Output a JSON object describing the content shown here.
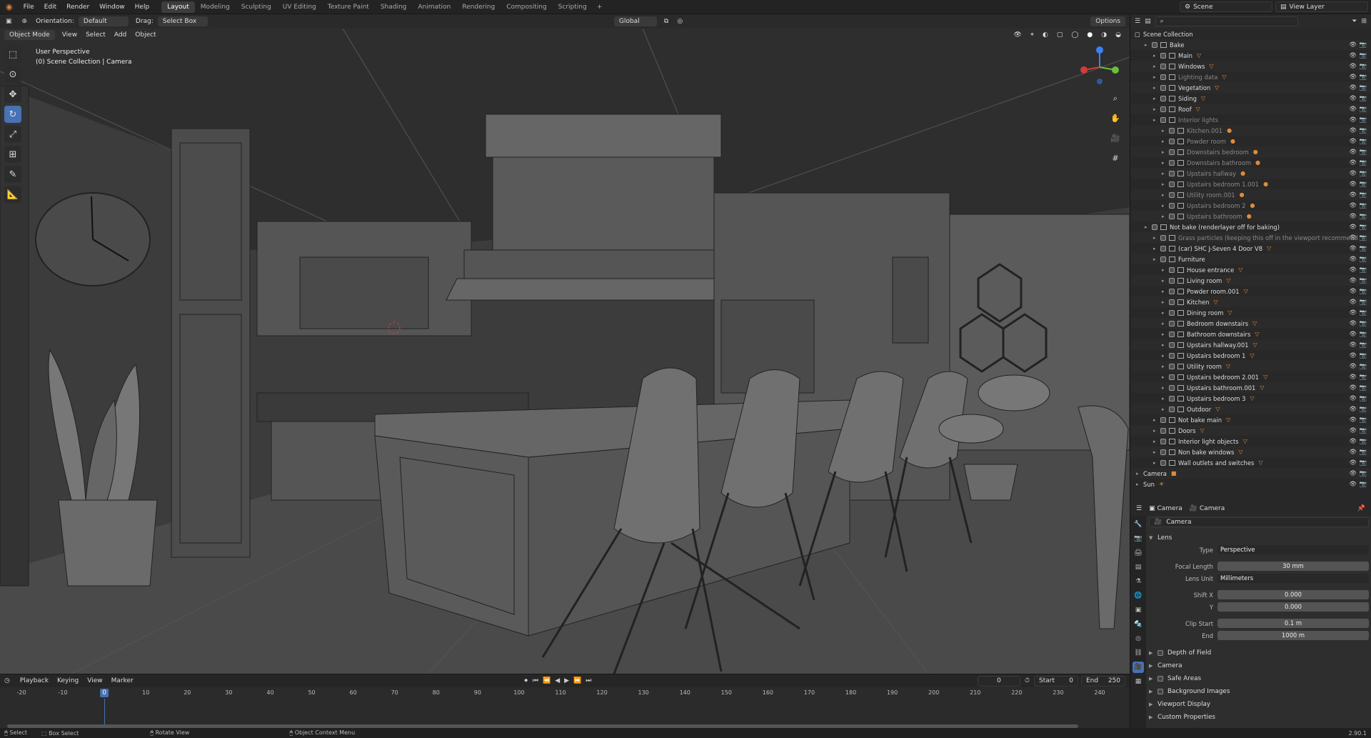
{
  "topbar": {
    "menu": [
      "File",
      "Edit",
      "Render",
      "Window",
      "Help"
    ],
    "workspaces": [
      "Layout",
      "Modeling",
      "Sculpting",
      "UV Editing",
      "Texture Paint",
      "Shading",
      "Animation",
      "Rendering",
      "Compositing",
      "Scripting"
    ],
    "active_workspace": "Layout",
    "scene": "Scene",
    "view_layer": "View Layer"
  },
  "viewport_header": {
    "orientation_label": "Orientation:",
    "orientation_value": "Default",
    "drag_label": "Drag:",
    "drag_value": "Select Box",
    "transform_space": "Global",
    "options": "Options",
    "mode": "Object Mode",
    "view": "View",
    "select": "Select",
    "add": "Add",
    "object": "Object"
  },
  "viewport": {
    "perspective": "User Perspective",
    "collection_info": "(0) Scene Collection | Camera"
  },
  "outliner": {
    "root": "Scene Collection",
    "rows": [
      {
        "indent": 1,
        "label": "Bake",
        "dim": false,
        "icon": ""
      },
      {
        "indent": 2,
        "label": "Main",
        "dim": false,
        "icon": "▽"
      },
      {
        "indent": 2,
        "label": "Windows",
        "dim": false,
        "icon": "▽"
      },
      {
        "indent": 2,
        "label": "Lighting data",
        "dim": true,
        "icon": "▽"
      },
      {
        "indent": 2,
        "label": "Vegetation",
        "dim": false,
        "icon": "▽"
      },
      {
        "indent": 2,
        "label": "Siding",
        "dim": false,
        "icon": "▽"
      },
      {
        "indent": 2,
        "label": "Roof",
        "dim": false,
        "icon": "▽"
      },
      {
        "indent": 2,
        "label": "Interior lights",
        "dim": true,
        "icon": ""
      },
      {
        "indent": 3,
        "label": "Kitchen.001",
        "dim": true,
        "icon": "●"
      },
      {
        "indent": 3,
        "label": "Powder room",
        "dim": true,
        "icon": "●"
      },
      {
        "indent": 3,
        "label": "Downstairs bedroom",
        "dim": true,
        "icon": "●"
      },
      {
        "indent": 3,
        "label": "Downstairs bathroom",
        "dim": true,
        "icon": "●"
      },
      {
        "indent": 3,
        "label": "Upstairs hallway",
        "dim": true,
        "icon": "●"
      },
      {
        "indent": 3,
        "label": "Upstairs bedroom 1.001",
        "dim": true,
        "icon": "●"
      },
      {
        "indent": 3,
        "label": "Utility room.001",
        "dim": true,
        "icon": "●"
      },
      {
        "indent": 3,
        "label": "Upstairs bedroom 2",
        "dim": true,
        "icon": "●"
      },
      {
        "indent": 3,
        "label": "Upstairs bathroom",
        "dim": true,
        "icon": "●"
      },
      {
        "indent": 1,
        "label": "Not bake (renderlayer off for baking)",
        "dim": false,
        "icon": ""
      },
      {
        "indent": 2,
        "label": "Grass particles (keeping this off in the viewport recommend",
        "dim": true,
        "icon": ""
      },
      {
        "indent": 2,
        "label": "(car) SHC J-Seven 4 Door V8",
        "dim": false,
        "icon": "▽"
      },
      {
        "indent": 2,
        "label": "Furniture",
        "dim": false,
        "icon": ""
      },
      {
        "indent": 3,
        "label": "House entrance",
        "dim": false,
        "icon": "▽"
      },
      {
        "indent": 3,
        "label": "Living room",
        "dim": false,
        "icon": "▽"
      },
      {
        "indent": 3,
        "label": "Powder room.001",
        "dim": false,
        "icon": "▽"
      },
      {
        "indent": 3,
        "label": "Kitchen",
        "dim": false,
        "icon": "▽"
      },
      {
        "indent": 3,
        "label": "Dining room",
        "dim": false,
        "icon": "▽"
      },
      {
        "indent": 3,
        "label": "Bedroom downstairs",
        "dim": false,
        "icon": "▽"
      },
      {
        "indent": 3,
        "label": "Bathroom downstairs",
        "dim": false,
        "icon": "▽"
      },
      {
        "indent": 3,
        "label": "Upstairs hallway.001",
        "dim": false,
        "icon": "▽"
      },
      {
        "indent": 3,
        "label": "Upstairs bedroom 1",
        "dim": false,
        "icon": "▽"
      },
      {
        "indent": 3,
        "label": "Utility room",
        "dim": false,
        "icon": "▽"
      },
      {
        "indent": 3,
        "label": "Upstairs bedroom 2.001",
        "dim": false,
        "icon": "▽"
      },
      {
        "indent": 3,
        "label": "Upstairs bathroom.001",
        "dim": false,
        "icon": "▽"
      },
      {
        "indent": 3,
        "label": "Upstairs bedroom 3",
        "dim": false,
        "icon": "▽"
      },
      {
        "indent": 3,
        "label": "Outdoor",
        "dim": false,
        "icon": "▽"
      },
      {
        "indent": 2,
        "label": "Not bake main",
        "dim": false,
        "icon": "▽"
      },
      {
        "indent": 2,
        "label": "Doors",
        "dim": false,
        "icon": "▽"
      },
      {
        "indent": 2,
        "label": "Interior light objects",
        "dim": false,
        "icon": "▽"
      },
      {
        "indent": 2,
        "label": "Non bake windows",
        "dim": false,
        "icon": "▽"
      },
      {
        "indent": 2,
        "label": "Wall outlets and switches",
        "dim": false,
        "icon": "▽"
      },
      {
        "indent": 0,
        "label": "Camera",
        "dim": false,
        "icon": "■"
      },
      {
        "indent": 0,
        "label": "Sun",
        "dim": false,
        "icon": "☀"
      }
    ]
  },
  "properties": {
    "object_tab": "Camera",
    "data_tab": "Camera",
    "datablock": "Camera",
    "lens_section": "Lens",
    "type_label": "Type",
    "type_value": "Perspective",
    "focal_label": "Focal Length",
    "focal_value": "30 mm",
    "lensunit_label": "Lens Unit",
    "lensunit_value": "Millimeters",
    "shiftx_label": "Shift X",
    "shiftx_value": "0.000",
    "shifty_label": "Y",
    "shifty_value": "0.000",
    "clipstart_label": "Clip Start",
    "clipstart_value": "0.1 m",
    "clipend_label": "End",
    "clipend_value": "1000 m",
    "sections": [
      "Depth of Field",
      "Camera",
      "Safe Areas",
      "Background Images",
      "Viewport Display",
      "Custom Properties"
    ]
  },
  "timeline": {
    "playback": "Playback",
    "keying": "Keying",
    "view": "View",
    "marker": "Marker",
    "current_frame": "0",
    "start_label": "Start",
    "start_value": "0",
    "end_label": "End",
    "end_value": "250",
    "ticks": [
      "-20",
      "-10",
      "0",
      "10",
      "20",
      "30",
      "40",
      "50",
      "60",
      "70",
      "80",
      "90",
      "100",
      "110",
      "120",
      "130",
      "140",
      "150",
      "160",
      "170",
      "180",
      "190",
      "200",
      "210",
      "220",
      "230",
      "240"
    ]
  },
  "statusbar": {
    "select": "Select",
    "box_select": "Box Select",
    "rotate_view": "Rotate View",
    "context_menu": "Object Context Menu",
    "version": "2.90.1"
  }
}
